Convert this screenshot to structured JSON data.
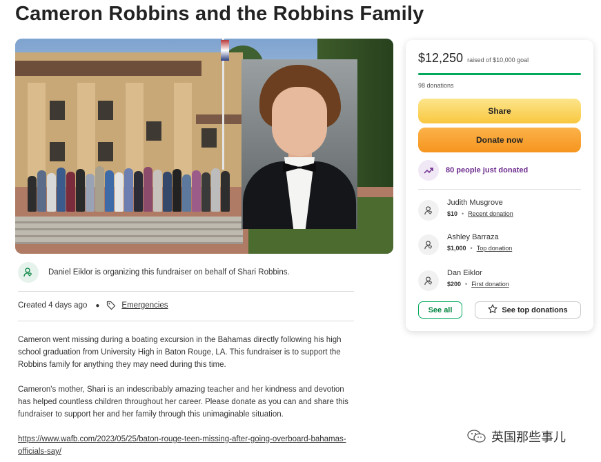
{
  "page": {
    "title": "Cameron Robbins and the Robbins Family"
  },
  "organizer": {
    "text": "Daniel Eiklor is organizing this fundraiser on behalf of Shari Robbins."
  },
  "meta": {
    "created": "Created 4 days ago",
    "category": "Emergencies"
  },
  "story": {
    "paragraph1": "Cameron went missing during a boating excursion in the Bahamas directly following his high school graduation from University High in Baton Rouge, LA. This fundraiser is to support the Robbins family for anything they may need during this time.",
    "paragraph2": "Cameron's mother, Shari is an indescribably amazing teacher and her kindness and devotion has helped countless children throughout her career. Please donate as you can and share this fundraiser to support her and her family through this unimaginable situation.",
    "link": "https://www.wafb.com/2023/05/25/baton-rouge-teen-missing-after-going-overboard-bahamas-officials-say/"
  },
  "donation_card": {
    "raised": "$12,250",
    "goal_text": "raised of $10,000 goal",
    "progress_fraction": 1.0,
    "donations_count": "98 donations",
    "share_label": "Share",
    "donate_label": "Donate now",
    "trend_text": "80 people just donated",
    "donors": [
      {
        "name": "Judith Musgrove",
        "amount": "$10",
        "kind": "Recent donation"
      },
      {
        "name": "Ashley Barraza",
        "amount": "$1,000",
        "kind": "Top donation"
      },
      {
        "name": "Dan Eiklor",
        "amount": "$200",
        "kind": "First donation"
      }
    ],
    "see_all_label": "See all",
    "see_top_label": "See top donations"
  },
  "watermark": {
    "text": "英国那些事儿"
  },
  "colors": {
    "accent_green": "#02a95c",
    "share_yellow": "#f9c740",
    "donate_orange": "#f6951f",
    "trend_purple": "#6b2a8c"
  },
  "icons": [
    "person-heart-icon",
    "tag-icon",
    "trending-up-icon",
    "donor-heart-icon",
    "star-icon",
    "wechat-logo-icon"
  ]
}
